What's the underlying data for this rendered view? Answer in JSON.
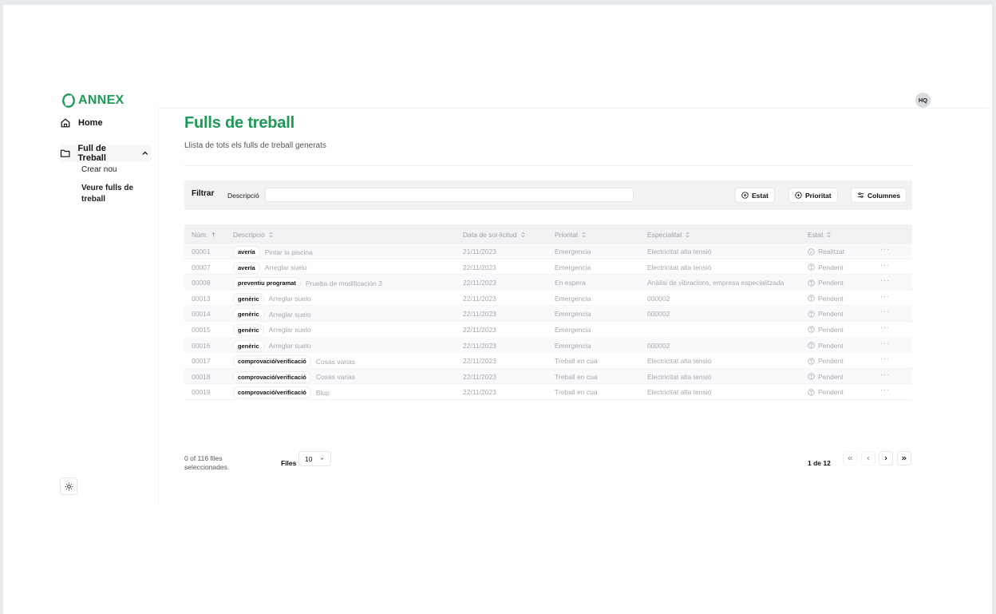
{
  "app": {
    "logo_text": "ANNEX",
    "brand_color": "#1d9a55",
    "user_initials": "HQ"
  },
  "sidebar": {
    "home_label": "Home",
    "full_label": "Full de Treball",
    "sub_items": [
      "Crear nou",
      "Veure fulls de treball"
    ],
    "theme_icon": "sun-icon"
  },
  "main": {
    "title": "Fulls de treball",
    "subtitle": "Llista de tots els fulls de treball generats"
  },
  "filter": {
    "title": "Filtrar",
    "field_label": "Descripció",
    "input_value": "",
    "buttons": {
      "estat": "Estat",
      "prioritat": "Prioritat",
      "columnes": "Columnes"
    }
  },
  "table": {
    "headers": [
      "Núm.",
      "Descripció",
      "Data de sol·licitud",
      "Prioritat",
      "Especialitat",
      "Estat"
    ],
    "rows": [
      {
        "num": "00001",
        "tag": "avería",
        "desc": "Pintar la piscina",
        "date": "21/11/2023",
        "prio": "Emergencia",
        "esp": "Electricitat alta tensió",
        "estat": "Realitzat",
        "estat_icon": "check-circle-icon"
      },
      {
        "num": "00007",
        "tag": "avería",
        "desc": "Arreglar suelo",
        "date": "22/11/2023",
        "prio": "Emergencia",
        "esp": "Electricitat alta tensió",
        "estat": "Pendent",
        "estat_icon": "question-circle-icon"
      },
      {
        "num": "00008",
        "tag": "preventiu programat",
        "desc": "Prueba de modificación 3",
        "date": "22/11/2023",
        "prio": "En espera",
        "esp": "Anàlisi de vibracions, empresa especialitzada",
        "estat": "Pendent",
        "estat_icon": "question-circle-icon"
      },
      {
        "num": "00013",
        "tag": "genèric",
        "desc": "Arreglar suelo",
        "date": "22/11/2023",
        "prio": "Emergencia",
        "esp": "000002",
        "estat": "Pendent",
        "estat_icon": "question-circle-icon"
      },
      {
        "num": "00014",
        "tag": "genèric",
        "desc": "Arreglar suelo",
        "date": "22/11/2023",
        "prio": "Emergencia",
        "esp": "000002",
        "estat": "Pendent",
        "estat_icon": "question-circle-icon"
      },
      {
        "num": "00015",
        "tag": "genèric",
        "desc": "Arreglar suelo",
        "date": "22/11/2023",
        "prio": "Emergencia",
        "esp": "",
        "estat": "Pendent",
        "estat_icon": "question-circle-icon"
      },
      {
        "num": "00016",
        "tag": "genèric",
        "desc": "Arreglar suelo",
        "date": "22/11/2023",
        "prio": "Emergencia",
        "esp": "000002",
        "estat": "Pendent",
        "estat_icon": "question-circle-icon"
      },
      {
        "num": "00017",
        "tag": "comprovació/verificació",
        "desc": "Cosas varias",
        "date": "22/11/2023",
        "prio": "Treball en cua",
        "esp": "Electricitat alta tensió",
        "estat": "Pendent",
        "estat_icon": "question-circle-icon"
      },
      {
        "num": "00018",
        "tag": "comprovació/verificació",
        "desc": "Cosas varias",
        "date": "22/11/2023",
        "prio": "Treball en cua",
        "esp": "Electricitat alta tensió",
        "estat": "Pendent",
        "estat_icon": "question-circle-icon"
      },
      {
        "num": "00019",
        "tag": "comprovació/verificació",
        "desc": "Blup",
        "date": "22/11/2023",
        "prio": "Treball en cua",
        "esp": "Electricitat alta tensió",
        "estat": "Pendent",
        "estat_icon": "question-circle-icon"
      }
    ],
    "row_action": "···"
  },
  "footer": {
    "selection_info": "0 of 116 files seleccionades.",
    "rows_label": "Files",
    "rows_value": "10",
    "page_info": "1 de 12"
  }
}
